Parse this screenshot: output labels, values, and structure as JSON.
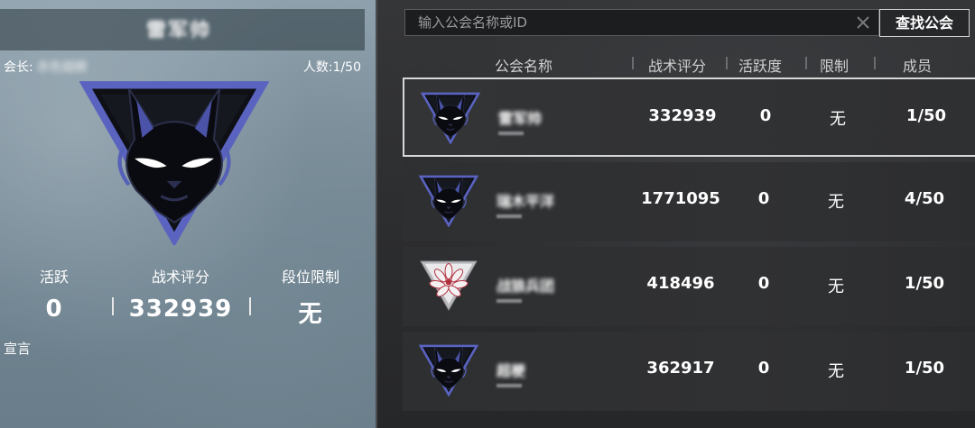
{
  "selected_guild": {
    "name": "雷军帅",
    "leader_label": "会长:",
    "leader_name": "赤色翅膀",
    "members_label": "人数:1/50",
    "stats": [
      {
        "label": "活跃",
        "value": "0"
      },
      {
        "label": "战术评分",
        "value": "332939"
      },
      {
        "label": "段位限制",
        "value": "无"
      }
    ],
    "declaration_label": "宣言"
  },
  "search": {
    "placeholder": "输入公会名称或ID",
    "button_label": "查找公会"
  },
  "table": {
    "columns": [
      "公会名称",
      "战术评分",
      "活跃度",
      "限制",
      "成员"
    ],
    "rows": [
      {
        "emblem": "black-cat-emblem",
        "name": "雷军帅",
        "score": "332939",
        "activity": "0",
        "limit": "无",
        "members": "1/50",
        "selected": true
      },
      {
        "emblem": "black-cat-emblem",
        "name": "瑞木平洋",
        "score": "1771095",
        "activity": "0",
        "limit": "无",
        "members": "4/50",
        "selected": false
      },
      {
        "emblem": "pink-lotus-emblem",
        "name": "战狼兵团",
        "score": "418496",
        "activity": "0",
        "limit": "无",
        "members": "1/50",
        "selected": false
      },
      {
        "emblem": "black-cat-emblem",
        "name": "超梗",
        "score": "362917",
        "activity": "0",
        "limit": "无",
        "members": "1/50",
        "selected": false
      }
    ]
  },
  "colors": {
    "accent_border": "#d8d8d8",
    "emblem_blue": "#5560b8",
    "emblem_pink": "#c0404e"
  }
}
